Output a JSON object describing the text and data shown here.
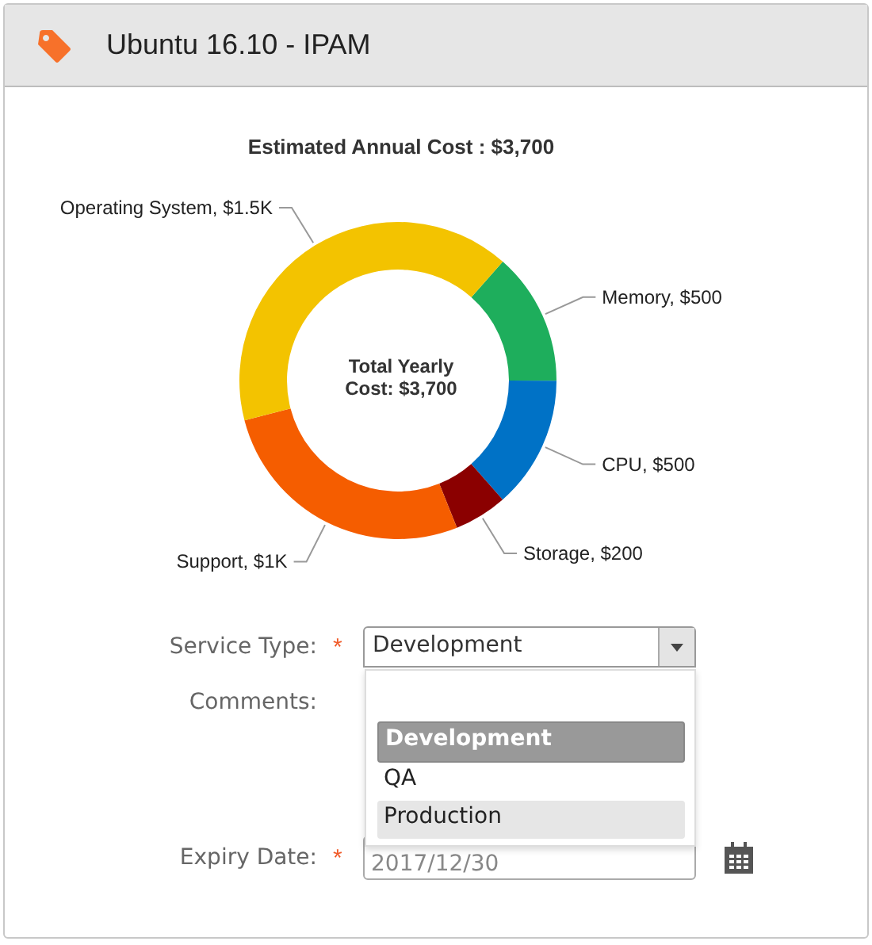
{
  "header": {
    "title": "Ubuntu 16.10 - IPAM"
  },
  "chart": {
    "chart_data": {
      "type": "donut",
      "title": "Estimated Annual Cost : $3,700",
      "series": [
        {
          "values": [
            13.51,
            13.51,
            5.41,
            27.03,
            40.54
          ]
        }
      ],
      "colors": [
        "#1eae5c",
        "#0072c6",
        "#8b0000",
        "#f55d00",
        "#f3c300"
      ],
      "value_labels": [
        "Memory, $500",
        "CPU, $500",
        "Storage, $200",
        "Support, $1K",
        "Operating System, $1.5K"
      ],
      "annotations": [
        "Total Yearly Cost: $3,700"
      ]
    }
  },
  "form": {
    "service_type": {
      "label": "Service Type:",
      "required_mark": "*",
      "value": "Development",
      "expanded": true,
      "options": [
        {
          "label": "Development",
          "selected": true,
          "hovered": false
        },
        {
          "label": "QA",
          "selected": false,
          "hovered": false
        },
        {
          "label": "Production",
          "selected": false,
          "hovered": true
        }
      ]
    },
    "comments": {
      "label": "Comments:"
    },
    "expiry_date": {
      "label": "Expiry Date:",
      "required_mark": "*",
      "value": "2017/12/30"
    }
  }
}
